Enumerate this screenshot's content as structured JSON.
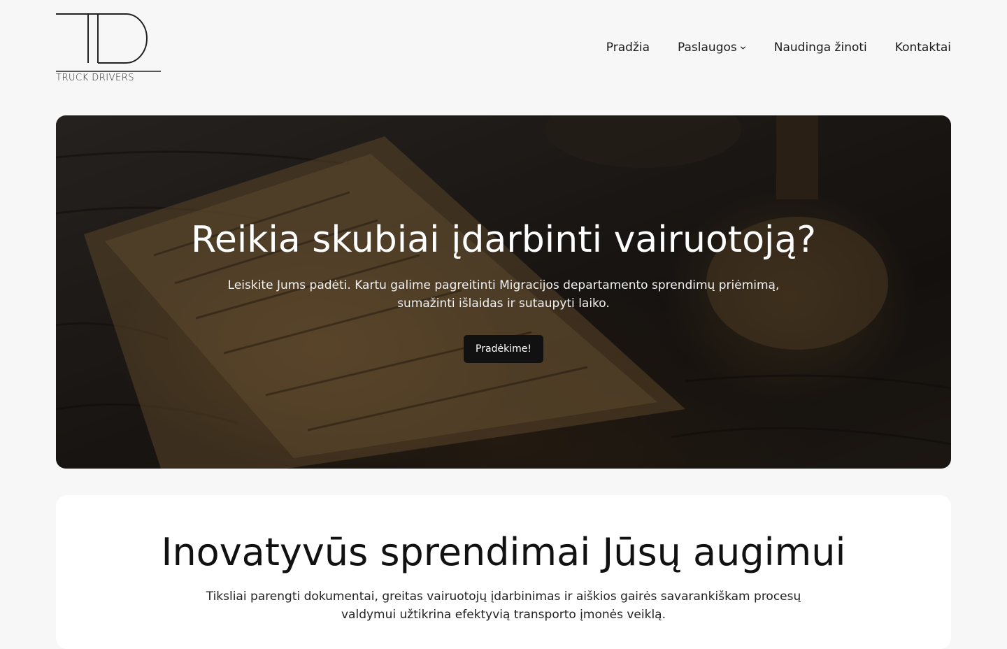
{
  "header": {
    "logo_text": "TRUCK DRIVERS",
    "nav": [
      {
        "label": "Pradžia"
      },
      {
        "label": "Paslaugos",
        "has_dropdown": true
      },
      {
        "label": "Naudinga žinoti"
      },
      {
        "label": "Kontaktai"
      }
    ]
  },
  "hero": {
    "title": "Reikia skubiai įdarbinti vairuotoją?",
    "subtitle": "Leiskite Jums padėti. Kartu galime pagreitinti Migracijos departamento sprendimų priėmimą, sumažinti išlaidas ir sutaupyti laiko.",
    "button_label": "Pradėkime!"
  },
  "intro": {
    "title": "Inovatyvūs sprendimai Jūsų augimui",
    "text": "Tiksliai parengti dokumentai, greitas vairuotojų įdarbinimas ir aiškios gairės savarankiškam procesų valdymui užtikrina efektyvią transporto įmonės veiklą."
  },
  "icons": {
    "dropdown": "chevron-down-icon"
  }
}
